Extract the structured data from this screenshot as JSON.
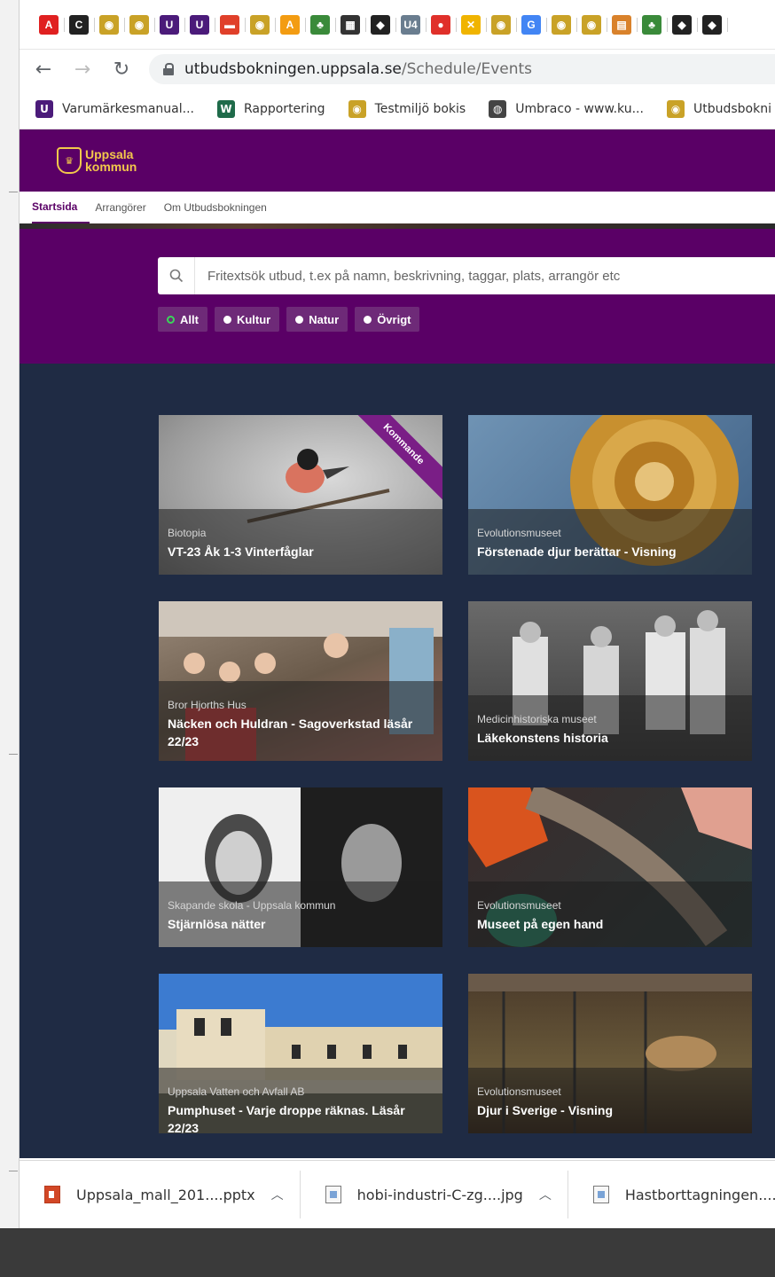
{
  "browser": {
    "tabs": [
      {
        "icon": "adobe-icon",
        "glyph": "A",
        "color": "#e02020"
      },
      {
        "icon": "c-icon",
        "glyph": "C",
        "color": "#222222"
      },
      {
        "icon": "uppsala-shield-icon",
        "glyph": "◉",
        "color": "#c9a227"
      },
      {
        "icon": "uppsala-shield-icon",
        "glyph": "◉",
        "color": "#c9a227"
      },
      {
        "icon": "u-icon",
        "glyph": "U",
        "color": "#4b1b7a"
      },
      {
        "icon": "u-icon",
        "glyph": "U",
        "color": "#4b1b7a"
      },
      {
        "icon": "red-banner-icon",
        "glyph": "▬",
        "color": "#e0402a"
      },
      {
        "icon": "uppsala-shield-icon",
        "glyph": "◉",
        "color": "#c9a227"
      },
      {
        "icon": "orange-a-icon",
        "glyph": "A",
        "color": "#f39c12"
      },
      {
        "icon": "tree-icon",
        "glyph": "♣",
        "color": "#3a8a3a"
      },
      {
        "icon": "theater-icon",
        "glyph": "▦",
        "color": "#333333"
      },
      {
        "icon": "shield-icon",
        "glyph": "◆",
        "color": "#222222"
      },
      {
        "icon": "u4-icon",
        "glyph": "U4",
        "color": "#6a7d8f"
      },
      {
        "icon": "map-pin-icon",
        "glyph": "●",
        "color": "#e0302a"
      },
      {
        "icon": "x-icon",
        "glyph": "✕",
        "color": "#f0b400"
      },
      {
        "icon": "uppsala-shield-icon",
        "glyph": "◉",
        "color": "#c9a227"
      },
      {
        "icon": "google-icon",
        "glyph": "G",
        "color": "#4285f4"
      },
      {
        "icon": "uppsala-shield-icon",
        "glyph": "◉",
        "color": "#c9a227"
      },
      {
        "icon": "uppsala-shield-icon",
        "glyph": "◉",
        "color": "#c9a227"
      },
      {
        "icon": "doc-icon",
        "glyph": "▤",
        "color": "#d9822b"
      },
      {
        "icon": "tree-icon",
        "glyph": "♣",
        "color": "#3a8a3a"
      },
      {
        "icon": "shield-icon",
        "glyph": "◆",
        "color": "#222222"
      },
      {
        "icon": "shield-icon",
        "glyph": "◆",
        "color": "#222222"
      }
    ],
    "address": {
      "domain": "utbudsbokningen.uppsala.se",
      "path": "/Schedule/Events"
    },
    "bookmarks": [
      {
        "label": "Varumärkesmanual...",
        "icon": "u-icon",
        "glyph": "U",
        "color": "#4b1b7a"
      },
      {
        "label": "Rapportering",
        "icon": "w-icon",
        "glyph": "W",
        "color": "#1f6b4a"
      },
      {
        "label": "Testmiljö bokis",
        "icon": "uppsala-shield-icon",
        "glyph": "◉",
        "color": "#c9a227"
      },
      {
        "label": "Umbraco - www.ku...",
        "icon": "globe-icon",
        "glyph": "◍",
        "color": "#444444"
      },
      {
        "label": "Utbudsbokni",
        "icon": "uppsala-shield-icon",
        "glyph": "◉",
        "color": "#c9a227"
      }
    ]
  },
  "site": {
    "logo": {
      "line1": "Uppsala",
      "line2": "kommun"
    },
    "nav": [
      "Startsida",
      "Arrangörer",
      "Om Utbudsbokningen"
    ],
    "search": {
      "placeholder": "Fritextsök utbud, t.ex på namn, beskrivning, taggar, plats, arrangör etc"
    },
    "filters": [
      "Allt",
      "Kultur",
      "Natur",
      "Övrigt"
    ]
  },
  "cards": [
    {
      "org": "Biotopia",
      "title": "VT-23 Åk 1-3 Vinterfåglar",
      "ribbon": "Kommande"
    },
    {
      "org": "Evolutionsmuseet",
      "title": "Förstenade djur berättar - Visning"
    },
    {
      "org": "Bror Hjorths Hus",
      "title": "Näcken och Huldran - Sagoverkstad läsår 22/23"
    },
    {
      "org": "Medicinhistoriska museet",
      "title": "Läkekonstens historia"
    },
    {
      "org": "Skapande skola - Uppsala kommun",
      "title": "Stjärnlösa nätter"
    },
    {
      "org": "Evolutionsmuseet",
      "title": "Museet på egen hand"
    },
    {
      "org": "Uppsala Vatten och Avfall AB",
      "title": "Pumphuset - Varje droppe räknas. Läsår 22/23"
    },
    {
      "org": "Evolutionsmuseet",
      "title": "Djur i Sverige - Visning"
    }
  ],
  "downloads": [
    {
      "name": "Uppsala_mall_201....pptx",
      "icon": "powerpoint-icon"
    },
    {
      "name": "hobi-industri-C-zg....jpg",
      "icon": "image-file-icon"
    },
    {
      "name": "Hastborttagningen....",
      "icon": "image-file-icon"
    }
  ]
}
